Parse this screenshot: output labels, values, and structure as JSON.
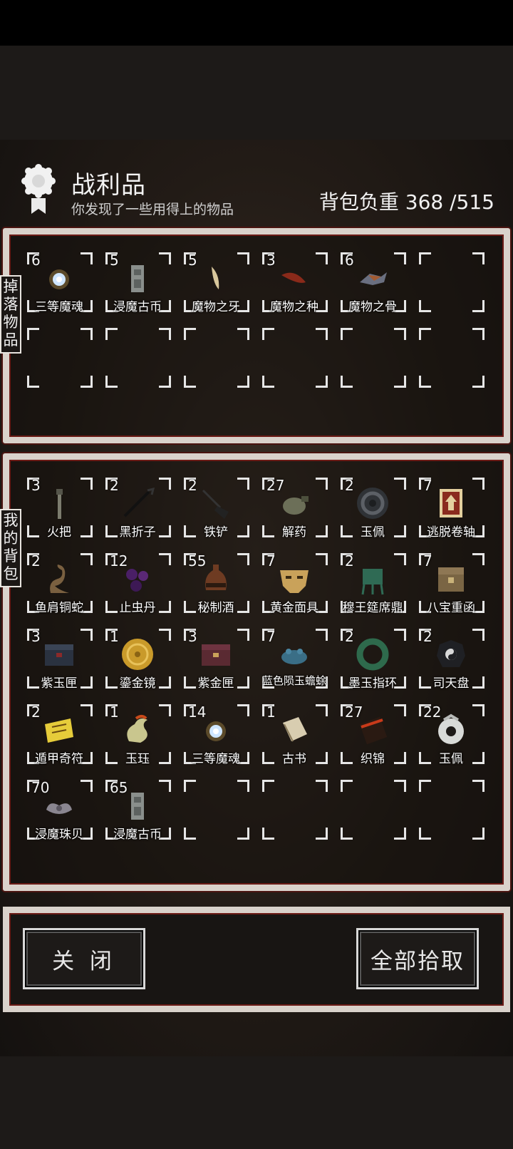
{
  "header": {
    "title": "战利品",
    "subtitle": "你发现了一些用得上的物品",
    "weight_label": "背包负重",
    "weight_value": "368 /515"
  },
  "drop_panel": {
    "tag": "掉落物品",
    "slots": [
      {
        "count": "6",
        "name": "三等魔魂",
        "icon": "soul-orb-icon"
      },
      {
        "count": "5",
        "name": "浸魔古币",
        "icon": "ancient-coin-icon"
      },
      {
        "count": "5",
        "name": "魔物之牙",
        "icon": "fang-icon"
      },
      {
        "count": "3",
        "name": "魔物之种",
        "icon": "seed-icon"
      },
      {
        "count": "6",
        "name": "魔物之骨",
        "icon": "bone-icon"
      },
      {
        "count": "",
        "name": "",
        "icon": ""
      },
      {
        "count": "",
        "name": "",
        "icon": ""
      },
      {
        "count": "",
        "name": "",
        "icon": ""
      },
      {
        "count": "",
        "name": "",
        "icon": ""
      },
      {
        "count": "",
        "name": "",
        "icon": ""
      },
      {
        "count": "",
        "name": "",
        "icon": ""
      },
      {
        "count": "",
        "name": "",
        "icon": ""
      }
    ]
  },
  "bag_panel": {
    "tag": "我的背包",
    "slots": [
      {
        "count": "3",
        "name": "火把",
        "icon": "torch-icon"
      },
      {
        "count": "2",
        "name": "黑折子",
        "icon": "fire-starter-icon"
      },
      {
        "count": "2",
        "name": "铁铲",
        "icon": "shovel-icon"
      },
      {
        "count": "27",
        "name": "解药",
        "icon": "antidote-icon"
      },
      {
        "count": "2",
        "name": "玉佩",
        "icon": "jade-disc-icon"
      },
      {
        "count": "7",
        "name": "逃脱卷轴",
        "icon": "scroll-icon"
      },
      {
        "count": "2",
        "name": "鱼肩铜蛇",
        "icon": "bronze-snake-icon"
      },
      {
        "count": "12",
        "name": "止虫丹",
        "icon": "pills-icon"
      },
      {
        "count": "55",
        "name": "秘制酒",
        "icon": "wine-jar-icon"
      },
      {
        "count": "7",
        "name": "黄金面具",
        "icon": "gold-mask-icon"
      },
      {
        "count": "2",
        "name": "穆王筵席鼎",
        "icon": "bronze-ding-icon"
      },
      {
        "count": "7",
        "name": "八宝重函",
        "icon": "treasure-box-icon"
      },
      {
        "count": "3",
        "name": "紫玉匣",
        "icon": "jade-casket-icon"
      },
      {
        "count": "1",
        "name": "鎏金镜",
        "icon": "gold-mirror-icon"
      },
      {
        "count": "3",
        "name": "紫金匣",
        "icon": "gold-casket-icon"
      },
      {
        "count": "7",
        "name": "蓝色陨玉蟾蜍",
        "icon": "blue-toad-icon"
      },
      {
        "count": "2",
        "name": "墨玉指环",
        "icon": "jade-ring-icon"
      },
      {
        "count": "2",
        "name": "司天盘",
        "icon": "bagua-plate-icon"
      },
      {
        "count": "2",
        "name": "遁甲奇符",
        "icon": "talisman-icon"
      },
      {
        "count": "1",
        "name": "玉珏",
        "icon": "jade-dragon-icon"
      },
      {
        "count": "14",
        "name": "三等魔魂",
        "icon": "soul-orb-icon"
      },
      {
        "count": "1",
        "name": "古书",
        "icon": "book-icon"
      },
      {
        "count": "27",
        "name": "织锦",
        "icon": "brocade-icon"
      },
      {
        "count": "22",
        "name": "玉佩",
        "icon": "jade-pendant-icon"
      },
      {
        "count": "70",
        "name": "浸魔珠贝",
        "icon": "shell-icon"
      },
      {
        "count": "65",
        "name": "浸魔古币",
        "icon": "ancient-coin-icon"
      },
      {
        "count": "",
        "name": "",
        "icon": ""
      },
      {
        "count": "",
        "name": "",
        "icon": ""
      },
      {
        "count": "",
        "name": "",
        "icon": ""
      },
      {
        "count": "",
        "name": "",
        "icon": ""
      }
    ]
  },
  "footer": {
    "close_label": "关 闭",
    "take_all_label": "全部拾取"
  }
}
